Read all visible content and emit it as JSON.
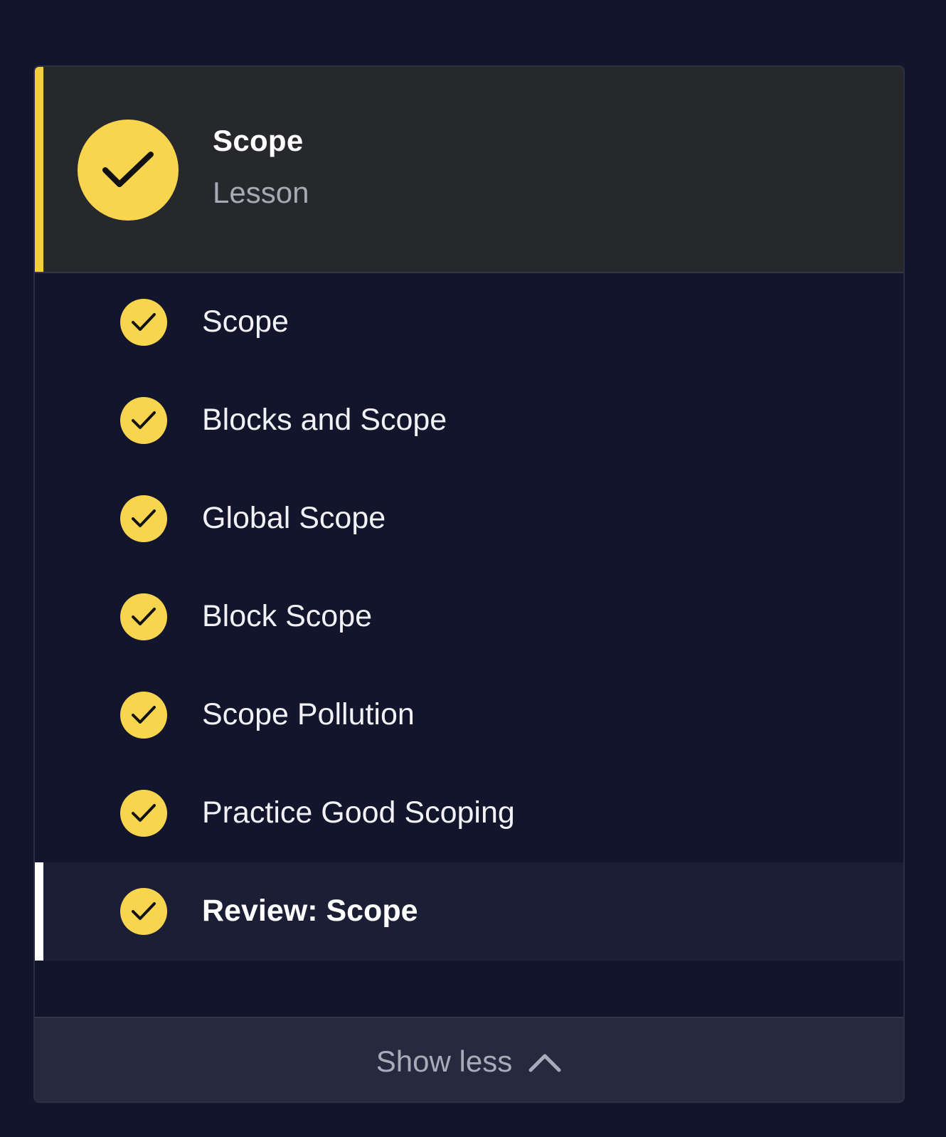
{
  "header": {
    "title": "Scope",
    "subtitle": "Lesson",
    "icon": "check-circle-icon",
    "accent_color": "#f4ce3e"
  },
  "items": [
    {
      "label": "Scope",
      "completed": true,
      "active": false
    },
    {
      "label": "Blocks and Scope",
      "completed": true,
      "active": false
    },
    {
      "label": "Global Scope",
      "completed": true,
      "active": false
    },
    {
      "label": "Block Scope",
      "completed": true,
      "active": false
    },
    {
      "label": "Scope Pollution",
      "completed": true,
      "active": false
    },
    {
      "label": "Practice Good Scoping",
      "completed": true,
      "active": false
    },
    {
      "label": "Review: Scope",
      "completed": true,
      "active": true
    }
  ],
  "footer": {
    "toggle_label": "Show less",
    "toggle_icon": "chevron-up-icon"
  },
  "colors": {
    "background": "#12152b",
    "header_bg": "#27282c",
    "check_fill": "#f8d54f",
    "active_indicator": "#ffffff"
  }
}
